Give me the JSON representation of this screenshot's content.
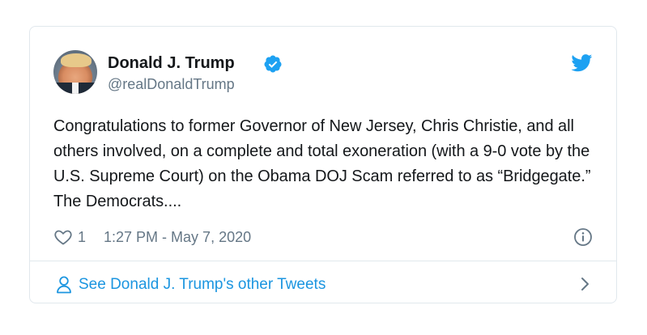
{
  "tweet": {
    "author_name": "Donald J. Trump",
    "handle": "@realDonaldTrump",
    "text": "Congratulations to former Governor of New Jersey, Chris Christie, and all others involved, on a complete and total exoneration (with a 9-0 vote by the U.S. Supreme Court) on the Obama DOJ Scam referred to as “Bridgegate.” The Democrats....",
    "like_count": "1",
    "timestamp": "1:27 PM - May 7, 2020",
    "footer_link": "See Donald J. Trump's other Tweets"
  },
  "icons": {
    "verified": "verified-badge-icon",
    "brand": "twitter-bird-icon",
    "like": "heart-icon",
    "info": "info-icon",
    "profile": "person-icon",
    "more": "chevron-right-icon"
  },
  "colors": {
    "brand_blue": "#1da1f2",
    "link_blue": "#1b95e0",
    "secondary_text": "#657786",
    "border": "#e1e8ed"
  }
}
